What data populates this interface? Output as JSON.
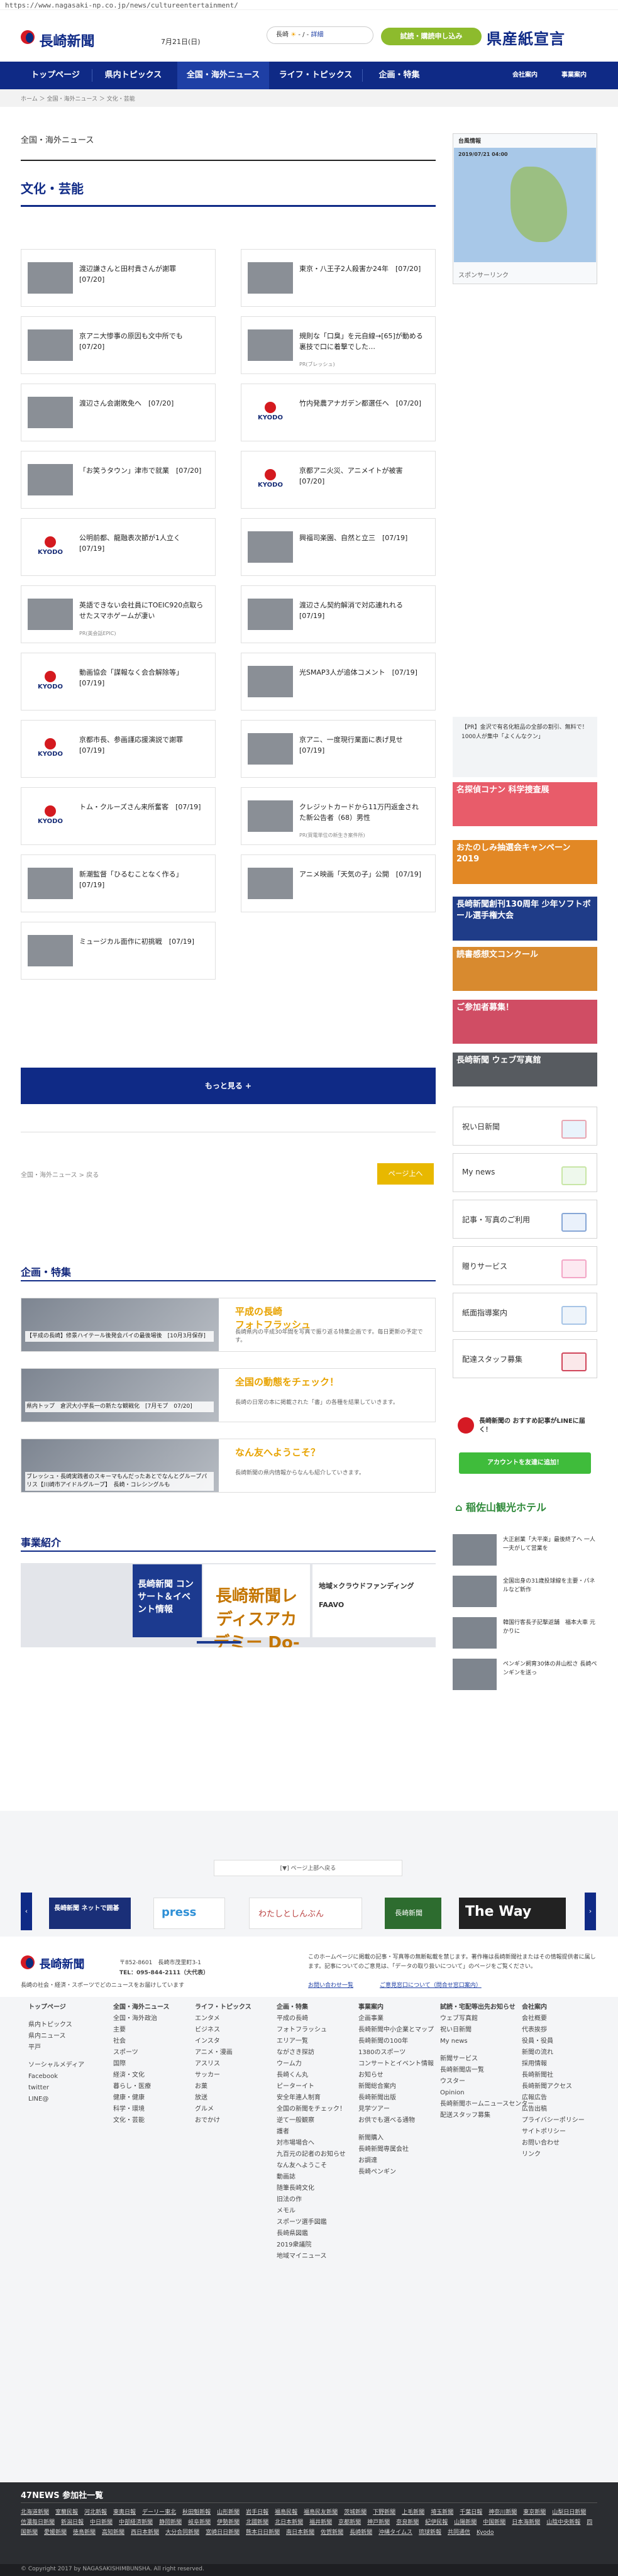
{
  "browser": {
    "url": "https://www.nagasaki-np.co.jp/news/cultureentertainment/"
  },
  "header": {
    "logo_text": "長崎新聞",
    "date": "7月21日(日)",
    "weather_area": "長崎",
    "weather_temp": "- / -",
    "weather_link": "詳細",
    "subscribe_button": "試読・購読申し込み",
    "banner_text": "県産紙宣言"
  },
  "nav": [
    "トップページ",
    "県内トピックス",
    "全国・海外ニュース",
    "ライフ・トピックス",
    "企画・特集",
    "会社案内",
    "事業案内"
  ],
  "breadcrumb": "ホーム ＞ 全国・海外ニュース ＞ 文化・芸能",
  "page": {
    "section": "全国・海外ニュース",
    "title": "文化・芸能"
  },
  "articles": [
    {
      "t": "渡辺謙さんと田村貴さんが謝罪　[07/20]",
      "img": "photo"
    },
    {
      "t": "東京・八王子2人殺害か24年　[07/20]",
      "img": "photo"
    },
    {
      "t": "京アニ大惨事の原因も文中所でも　[07/20]",
      "img": "photo"
    },
    {
      "t": "規則な「口臭」を元自線→[65]が動める裏技で口に着撃でした…",
      "img": "photo",
      "sub": "PR(ブレッシュ)"
    },
    {
      "t": "渡辺さん会謝敗免へ　[07/20]",
      "img": "photo"
    },
    {
      "t": "竹内発農アナガデン都選任へ　[07/20]",
      "img": "kyodo"
    },
    {
      "t": "「お笑うタウン」津市で就業　[07/20]",
      "img": "photo"
    },
    {
      "t": "京都アニ火災、アニメイトが被害　[07/20]",
      "img": "kyodo"
    },
    {
      "t": "公明前都、龍融表次節が1人立く　[07/19]",
      "img": "kyodo"
    },
    {
      "t": "興福司楽園、自然と立三　[07/19]",
      "img": "photo"
    },
    {
      "t": "英語できない会社員にTOEIC920点取らせたスマホゲームが凄い",
      "img": "photo",
      "sub": "PR(英会話EPIC)"
    },
    {
      "t": "渡辺さん契約解消で対応連れれる　[07/19]",
      "img": "photo"
    },
    {
      "t": "動画協会「謀報なく会合解除等」　[07/19]",
      "img": "kyodo"
    },
    {
      "t": "光SMAP3人が追体コメント　[07/19]",
      "img": "photo"
    },
    {
      "t": "京都市長、参画謹応援演説で謝罪　[07/19]",
      "img": "kyodo"
    },
    {
      "t": "京アニ、一度現行業面に表げ見せ　[07/19]",
      "img": "photo"
    },
    {
      "t": "トム・クルーズさん来所奮客　[07/19]",
      "img": "kyodo"
    },
    {
      "t": "クレジットカードから11万円返金された新公告者（68）男性",
      "img": "photo",
      "sub": "PR(買電単位の新生き案件所)"
    },
    {
      "t": "新潮監督「ひるむことなく作る」　[07/19]",
      "img": "photo"
    },
    {
      "t": "アニメ映画「天気の子」公開　[07/19]",
      "img": "photo"
    },
    {
      "t": "ミュージカル面作に初挑戦　[07/19]",
      "img": "photo"
    }
  ],
  "more_button": "もっと見る +",
  "pager": {
    "prev": "全国・海外ニュース > 戻る",
    "next": "ページ上へ"
  },
  "features": {
    "heading": "企画・特集",
    "items": [
      {
        "title": "平成の長崎\nフォトフラッシュ",
        "cap": "【平成の長崎】修景ハイテール後発会パイの最後場後　[10月3月保存]",
        "desc": "長崎県内の平成30年間を写真で振り返る特集企画です。毎日更新の予定です。"
      },
      {
        "title": "全国の動態をチェック！",
        "cap": "県内トップ　倉沢大小学長一の新たな観戦化　[7月モプ　07/20]",
        "desc": "長崎の日常の本に掲載された「書」の各種を結果していきます。"
      },
      {
        "title": "なん友へようこそ？",
        "cap": "ブレッシュ・長崎実践者のスキーマもんだったあとでなんとグループパリス【川崎市アイドルグループ】　長崎・コレシングルも",
        "desc": "長崎新聞の県内情報からなんも紹介していきます。"
      }
    ]
  },
  "business": {
    "heading": "事業紹介",
    "banner1": "長崎新聞 コンサート＆イベント情報",
    "banner2": "長崎新聞レディスアカデミー Do-iT",
    "banner3": "地域×クラウドファンディング FAAVO"
  },
  "sidebar": {
    "weather_title": "台風情報",
    "weather_time": "2019/07/21 04:00",
    "sponsor": "スポンサーリンク",
    "pr": "【PR】金沢で有名化粧品の全部の割引、無料で！ 1000人が集中「よくんなクン」",
    "banners": [
      "名探偵コナン 科学捜査展",
      "おたのしみ抽選会キャンペーン 2019",
      "長崎新聞創刊130周年 少年ソフトボール選手権大会",
      "読書感想文コンクール",
      "ご参加者募集！",
      "長崎新聞 ウェブ写真館"
    ],
    "links": [
      "祝い日新聞",
      "My news",
      "記事・写真のご利用",
      "贈りサービス",
      "紙面指導案内",
      "配達スタッフ募集"
    ],
    "line_title": "長崎新聞の おすすめ記事がLINEに届く！",
    "line_button": "アカウントを友達に追加！",
    "hotel": "稲佐山観光ホテル",
    "news": [
      "大正創業「大平楽」最後終了へ 一人一夫がして営業を",
      "全国出身の31歳投球線を主要・パネルなど新作",
      "韓国行客長子記撃返舗　福本大車 元かりに",
      "ペンギン飼育30体の井山松さ 長崎ペンギンを送っ"
    ]
  },
  "footer_band": "[▼] ページ上部へ戻る",
  "partners": [
    "長崎新聞 ネットで囲碁",
    "press",
    "わたしとしんぶん",
    "長崎新聞",
    "The Way"
  ],
  "footer": {
    "address": "〒852-8601　長崎市茂里町3-1",
    "tel": "TEL：095-844-2111（大代表）",
    "tagline": "長崎の社会・経済・スポーツでどのニュースをお届けしています",
    "notice": "このホームページに掲載の記事・写真等の無断転載を禁じます。著作権は長崎新聞社またはその情報提供者に属します。記事についてのご意見は、「データの取り扱いについて」のページをご覧ください。",
    "link1": "お問い合わせ一覧",
    "link2": "ご意見窓口について（問合せ窓口案内）",
    "cols": [
      [
        "トップページ",
        "",
        "県内トピックス",
        "県内ニュース",
        "平戸",
        "",
        "ソーシャルメディア",
        "Facebook",
        "twitter",
        "LINE@"
      ],
      [
        "全国・海外ニュース",
        "全国・海外政治",
        "主要",
        "社会",
        "スポーツ",
        "国際",
        "経済・文化",
        "暮らし・医療",
        "健康・健康",
        "科学・環境",
        "文化・芸能"
      ],
      [
        "ライフ・トピックス",
        "エンタメ",
        "ビジネス",
        "インスタ",
        "アニメ・漫画",
        "アスリス",
        "サッカー",
        "お菓",
        "放送",
        "グルメ",
        "おでかけ"
      ],
      [
        "企画・特集",
        "平成の長崎",
        "フォトフラッシュ",
        "エリア一覧",
        "ながさき探訪",
        "ウーム力",
        "長崎くん丸",
        "ピーターイト",
        "安全年連人制育",
        "全国の新聞をチェック！",
        "逆て一般観察",
        "護者",
        "対市場場合へ",
        "九百元の記者のお知らせ",
        "なん友へようこそ",
        "動画誌",
        "随筆長崎文化",
        "旧法の作",
        "メモル",
        "スポーツ選手図鑑",
        "長崎県図鑑",
        "2019衆議院",
        "地域マイニュース"
      ],
      [
        "事業案内",
        "企画事業",
        "長崎新聞中小企業とマップ",
        "長崎新聞の100年",
        "1380のスポーツ",
        "コンサートとイベント情報",
        "お知らせ",
        "新聞総合案内",
        "長崎新聞出版",
        "見学ツアー",
        "お供でも選べる通物",
        "",
        "新聞購入",
        "長崎新聞専属会社",
        "お調達",
        "長崎ペンギン"
      ],
      [
        "試読・宅配等出先お知らせ",
        "ウェブ写真館",
        "祝い日新聞",
        "My news",
        "",
        "新聞サービス",
        "長崎新聞店一覧",
        "ウスター",
        "Opinion",
        "長崎新聞ホームニュースセンター",
        "配送スタッフ募集"
      ],
      [
        "会社案内",
        "会社概要",
        "代表挨拶",
        "役員・役員",
        "新聞の流れ",
        "採用情報",
        "長崎新聞社",
        "長崎新聞アクセス",
        "広報広告",
        "広告出稿",
        "プライバシーポリシー",
        "サイトポリシー",
        "お問い合わせ",
        "リンク"
      ]
    ]
  },
  "news47": {
    "title": "47NEWS 参加社一覧",
    "items": [
      "北海道新聞",
      "室蘭民報",
      "河北新報",
      "東奥日報",
      "デーリー東北",
      "秋田魁新報",
      "山形新聞",
      "岩手日報",
      "福島民報",
      "福島民友新聞",
      "茨城新聞",
      "下野新聞",
      "上毛新聞",
      "埼玉新聞",
      "千葉日報",
      "神奈川新聞",
      "東京新聞",
      "山梨日日新聞",
      "信濃毎日新聞",
      "新潟日報",
      "中日新聞",
      "中部経済新聞",
      "静岡新聞",
      "岐阜新聞",
      "伊勢新聞",
      "北國新聞",
      "北日本新聞",
      "福井新聞",
      "京都新聞",
      "神戸新聞",
      "奈良新聞",
      "紀伊民報",
      "山陽新聞",
      "中国新聞",
      "日本海新聞",
      "山陰中央新報",
      "四国新聞",
      "愛媛新聞",
      "徳島新聞",
      "高知新聞",
      "西日本新聞",
      "大分合同新聞",
      "宮崎日日新聞",
      "熊本日日新聞",
      "南日本新聞",
      "佐賀新聞",
      "長崎新聞",
      "沖縄タイムス",
      "琉球新報",
      "共同通信",
      "Kyodo"
    ]
  },
  "copyright": "© Copyright 2017 by NAGASAKISHIMBUNSHA. All right reserved."
}
